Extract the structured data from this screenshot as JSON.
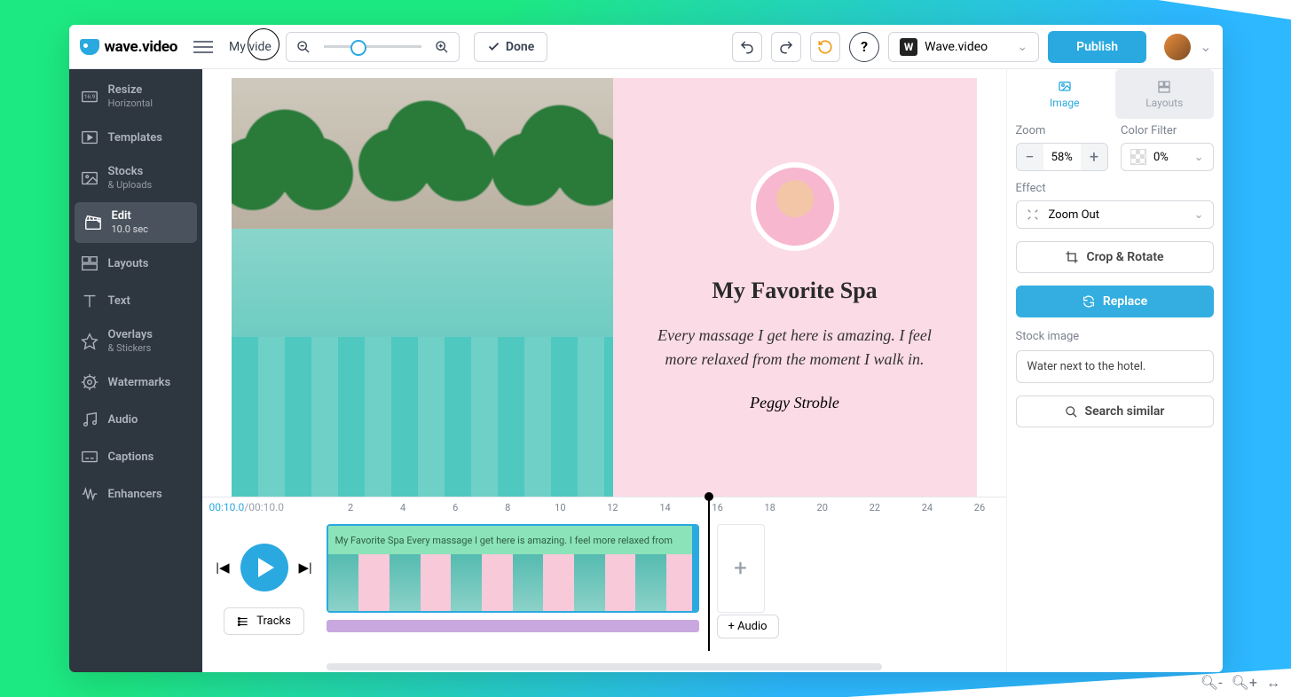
{
  "header": {
    "brand": "wave.video",
    "project_name": "My vide",
    "done_label": "Done",
    "workspace_badge": "W",
    "workspace_name": "Wave.video",
    "publish_label": "Publish"
  },
  "sidebar": {
    "items": [
      {
        "title": "Resize",
        "sub": "Horizontal",
        "icon": "aspect"
      },
      {
        "title": "Templates",
        "sub": "",
        "icon": "templates"
      },
      {
        "title": "Stocks",
        "sub": "& Uploads",
        "icon": "image"
      },
      {
        "title": "Edit",
        "sub": "10.0 sec",
        "icon": "clapper"
      },
      {
        "title": "Layouts",
        "sub": "",
        "icon": "layouts"
      },
      {
        "title": "Text",
        "sub": "",
        "icon": "text"
      },
      {
        "title": "Overlays",
        "sub": "& Stickers",
        "icon": "star"
      },
      {
        "title": "Watermarks",
        "sub": "",
        "icon": "gear"
      },
      {
        "title": "Audio",
        "sub": "",
        "icon": "music"
      },
      {
        "title": "Captions",
        "sub": "",
        "icon": "captions"
      },
      {
        "title": "Enhancers",
        "sub": "",
        "icon": "wave"
      }
    ],
    "active_index": 3
  },
  "canvas": {
    "title": "My Favorite Spa",
    "body": "Every massage I get here is amazing. I feel more relaxed from the moment I walk in.",
    "author": "Peggy Stroble"
  },
  "props": {
    "tabs": {
      "image": "Image",
      "layouts": "Layouts",
      "active": "image"
    },
    "zoom": {
      "label": "Zoom",
      "value": "58%"
    },
    "color_filter": {
      "label": "Color Filter",
      "value": "0%"
    },
    "effect": {
      "label": "Effect",
      "value": "Zoom Out"
    },
    "crop_label": "Crop & Rotate",
    "replace_label": "Replace",
    "stock_label": "Stock image",
    "stock_value": "Water next to the hotel.",
    "similar_label": "Search similar"
  },
  "timeline": {
    "current": "00:10.0",
    "total": "/00:10.0",
    "markers": [
      "2",
      "4",
      "6",
      "8",
      "10",
      "12",
      "14",
      "16",
      "18",
      "20",
      "22",
      "24",
      "26"
    ],
    "clip_text": "My Favorite Spa Every massage I get here is amazing. I feel more relaxed from",
    "tracks_label": "Tracks",
    "audio_label": "+ Audio"
  }
}
